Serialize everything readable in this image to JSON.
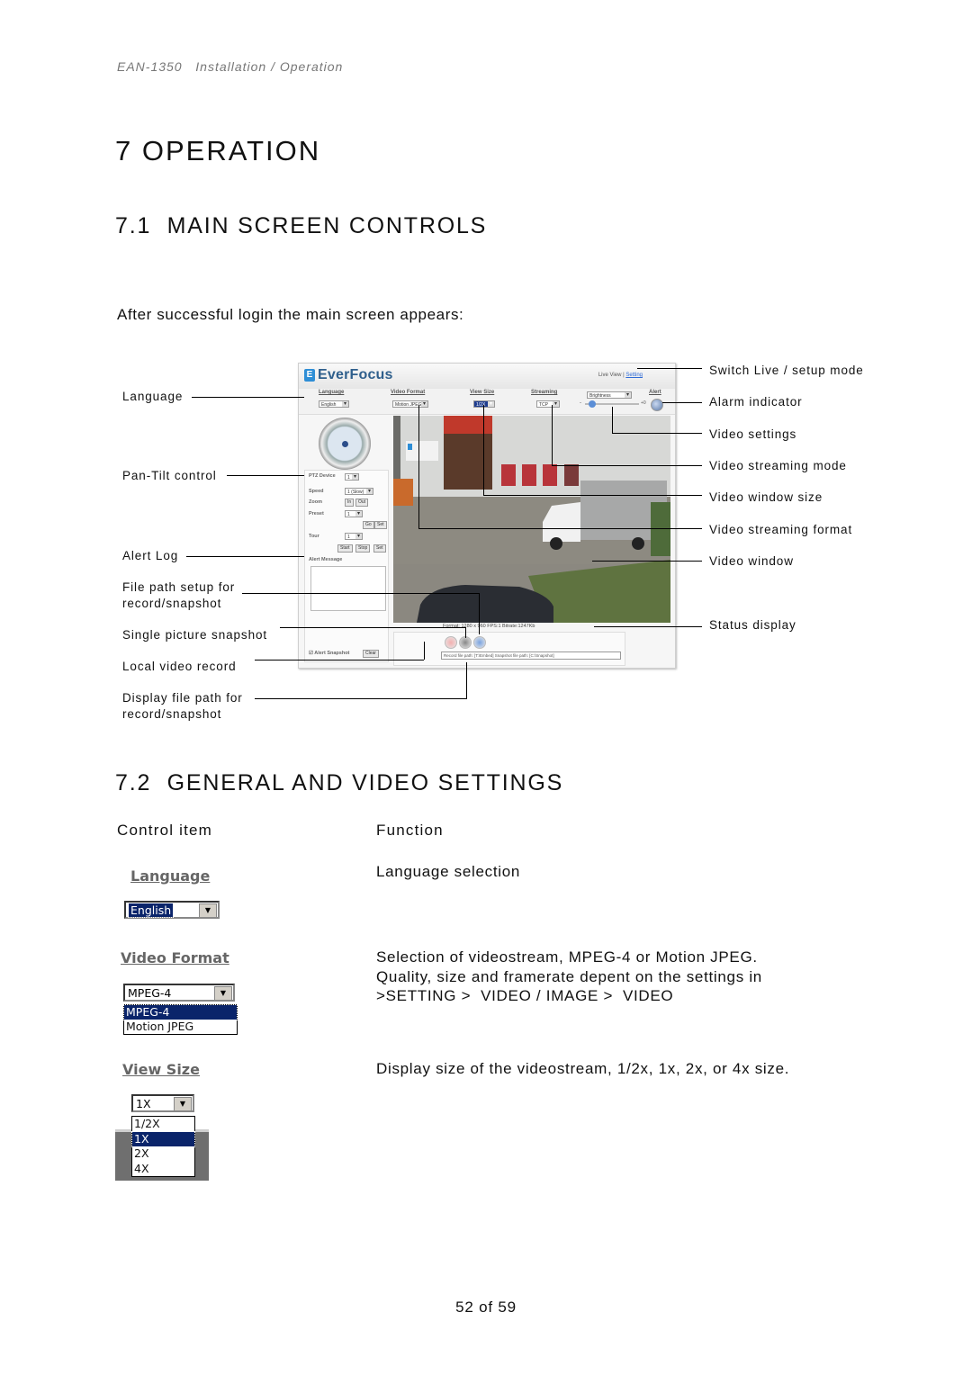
{
  "running_head": "EAN-1350   Installation / Operation",
  "chapter_title": "7 OPERATION",
  "section_7_1": {
    "title": "7.1  MAIN SCREEN CONTROLS",
    "lead": "After successful login the main screen appears:",
    "callouts_left": [
      "Language",
      "Pan-Tilt control",
      "Alert Log",
      "File path setup for\nrecord/snapshot",
      "Single picture snapshot",
      "Local video record",
      "Display file path for\nrecord/snapshot"
    ],
    "callouts_right": [
      "Switch Live / setup mode",
      "Alarm indicator",
      "Video settings",
      "Video streaming mode",
      "Video window size",
      "Video streaming format",
      "Video window",
      "Status display"
    ],
    "screenshot": {
      "brand": "EverFocus",
      "brand_mark": "E",
      "live_view": "Live View | ",
      "setting_link": "Setting",
      "toolbar": {
        "language_label": "Language",
        "language_value": "English",
        "video_format_label": "Video Format",
        "video_format_value": "Motion JPEG",
        "view_size_label": "View Size",
        "view_size_value": "1/2X",
        "streaming_label": "Streaming",
        "streaming_value": "TCP",
        "brightness_value": "Brightness",
        "slider_minus": "-",
        "slider_plus": "+0",
        "alert_label": "Alert"
      },
      "ptz": {
        "device_label": "PTZ Device",
        "device_value": "1",
        "speed_label": "Speed",
        "speed_value": "1 (Slow)",
        "zoom_label": "Zoom",
        "zoom_in": "In",
        "zoom_out": "Out",
        "preset_label": "Preset",
        "preset_value": "1",
        "go": "Go",
        "set": "Set",
        "tour_label": "Tour",
        "tour_value": "1",
        "start": "Start",
        "stop": "Stop",
        "tour_set": "Set",
        "alert_message_label": "Alert Message",
        "alert_snapshot_label": "Alert Snapshot",
        "clear": "Clear"
      },
      "status_text": "Format: 1280 x 960 FPS:1 Bitrate:1247Kb",
      "path_text": "Record file path: [T:\\Embed] Snapshot file path: [C:\\Snapshot]"
    }
  },
  "section_7_2": {
    "title": "7.2  GENERAL AND VIDEO SETTINGS",
    "col_control": "Control item",
    "col_function": "Function",
    "items": [
      {
        "label": "Language",
        "selected": "English",
        "options": [],
        "function": "Language selection"
      },
      {
        "label": "Video Format",
        "selected": "MPEG-4",
        "options": [
          "MPEG-4",
          "Motion JPEG"
        ],
        "function": "Selection of videostream, MPEG-4 or Motion JPEG.\nQuality, size and framerate depent on the settings in\n>SETTING >  VIDEO / IMAGE >  VIDEO"
      },
      {
        "label": "View Size",
        "selected": "1X",
        "options": [
          "1/2X",
          "1X",
          "2X",
          "4X"
        ],
        "function": "Display size of the videostream, 1/2x, 1x, 2x, or 4x size."
      }
    ]
  },
  "footer": {
    "page": "52 of 59"
  }
}
